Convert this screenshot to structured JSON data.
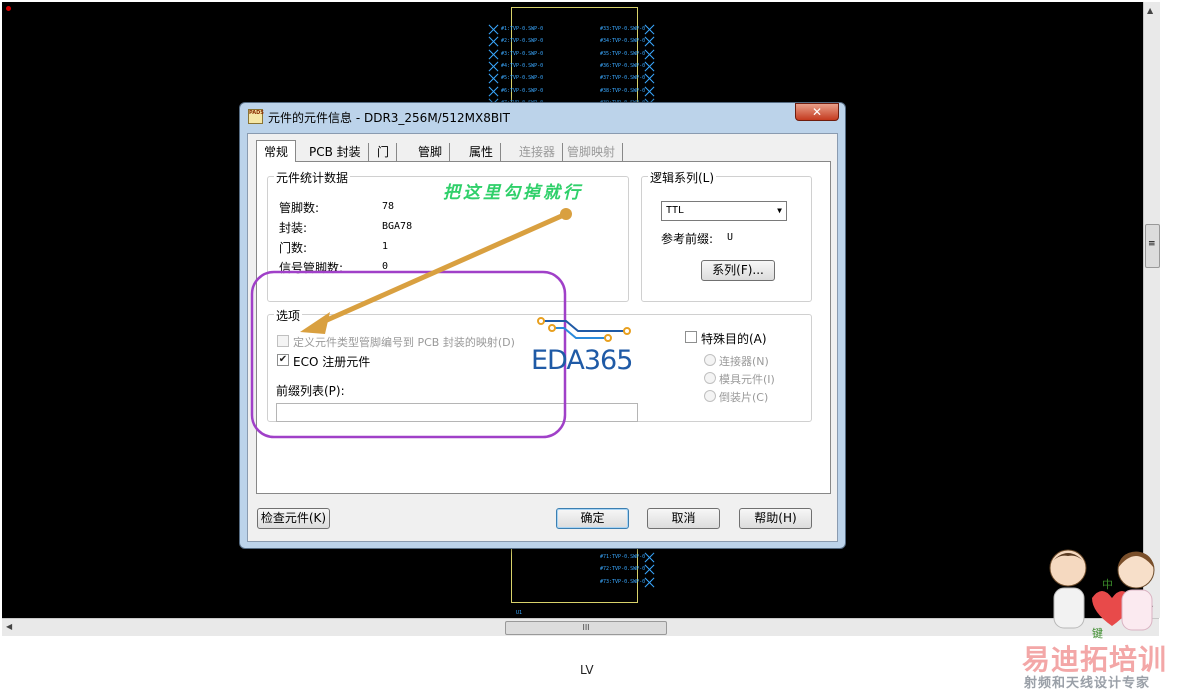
{
  "dialog": {
    "title": "元件的元件信息 - DDR3_256M/512MX8BIT",
    "app_icon_text": "PADS",
    "tabs": [
      {
        "label": "常规",
        "active": true,
        "enabled": true
      },
      {
        "label": "PCB 封装",
        "active": false,
        "enabled": true
      },
      {
        "label": "门",
        "active": false,
        "enabled": true
      },
      {
        "label": "管脚",
        "active": false,
        "enabled": true
      },
      {
        "label": "属性",
        "active": false,
        "enabled": true
      },
      {
        "label": "连接器",
        "active": false,
        "enabled": false
      },
      {
        "label": "管脚映射",
        "active": false,
        "enabled": false
      }
    ],
    "stats": {
      "title": "元件统计数据",
      "rows": [
        {
          "label": "管脚数:",
          "value": "78"
        },
        {
          "label": "封装:",
          "value": "BGA78"
        },
        {
          "label": "门数:",
          "value": "1"
        },
        {
          "label": "信号管脚数:",
          "value": "0"
        }
      ]
    },
    "logic": {
      "title": "逻辑系列(L)",
      "selected": "TTL",
      "ref_prefix_label": "参考前缀:",
      "ref_prefix_value": "U",
      "family_button": "系列(F)..."
    },
    "options": {
      "title": "选项",
      "define_pin_map": {
        "label": "定义元件类型管脚编号到 PCB 封装的映射(D)",
        "checked": false,
        "enabled": false
      },
      "eco_register": {
        "label": "ECO 注册元件",
        "checked": true,
        "enabled": true
      },
      "prefix_list_label": "前缀列表(P):",
      "prefix_list_value": "",
      "special_purpose": {
        "label": "特殊目的(A)",
        "checked": false
      },
      "special_radios": [
        "连接器(N)",
        "模具元件(I)",
        "倒装片(C)"
      ]
    },
    "buttons": {
      "check": "检查元件(K)",
      "ok": "确定",
      "cancel": "取消",
      "help": "帮助(H)"
    },
    "close_glyph": "✕"
  },
  "annotation": {
    "text": "把这里勾掉就行",
    "arrow_color": "#d9a040",
    "highlight_color": "#a040c8",
    "text_color": "#2fd06a"
  },
  "watermark": {
    "logo_text": "EDA365",
    "brand_title": "易迪拓培训",
    "brand_sub": "射频和天线设计专家",
    "mascot_text_1": "中",
    "mascot_text_2": "键"
  },
  "footer_label": "LV",
  "pcb": {
    "pins_left": [
      "#1:TVP-0.SWP-0",
      "#2:TVP-0.SWP-0",
      "#3:TVP-0.SWP-0",
      "#4:TVP-0.SWP-0",
      "#5:TVP-0.SWP-0",
      "#6:TVP-0.SWP-0",
      "#7:TVP-0.SWP-0",
      "#8:TVP-0.SWP-0"
    ],
    "pins_right": [
      "#33:TVP-0.SWP-0",
      "#34:TVP-0.SWP-0",
      "#35:TVP-0.SWP-0",
      "#36:TVP-0.SWP-0",
      "#37:TVP-0.SWP-0",
      "#38:TVP-0.SWP-0",
      "#39:TVP-0.SWP-0"
    ],
    "pins_right_bottom": [
      "#71:TVP-0.SWP-0",
      "#72:TVP-0.SWP-0",
      "#73:TVP-0.SWP-0"
    ],
    "bottom_tag": "U1",
    "hscroll_glyph": "III",
    "vscroll_glyph": "≡"
  },
  "colors": {
    "pcb_background": "#000000",
    "pin_color": "#3aa8ff",
    "component_outline": "#d8d26a",
    "dialog_frame": "#bcd3ea"
  }
}
